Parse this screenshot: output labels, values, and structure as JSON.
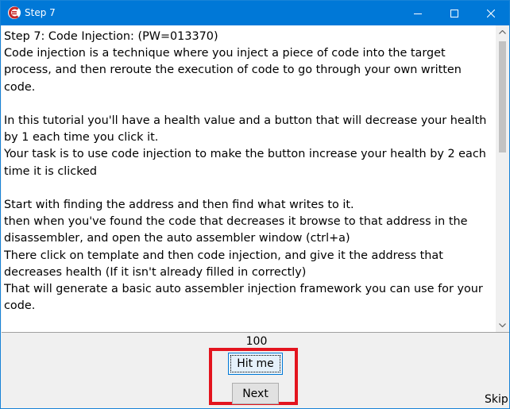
{
  "window": {
    "title": "Step 7"
  },
  "instructions": {
    "text": "Step 7: Code Injection: (PW=013370)\nCode injection is a technique where you inject a piece of code into the target process, and then reroute the execution of code to go through your own written code.\n\nIn this tutorial you'll have a health value and a button that will decrease your health by 1 each time you click it.\nYour task is to use code injection to make the button increase your health by 2 each time it is clicked\n\nStart with finding the address and then find what writes to it.\nthen when you've found the code that decreases it browse to that address in the disassembler, and open the auto assembler window (ctrl+a)\nThere click on template and then code injection, and give it the address that decreases health (If it isn't already filled in correctly)\nThat will generate a basic auto assembler injection framework you can use for your code.\n\nNotice the alloc, that will allocate a block of memory for your code cave, in the past, in the pre windows 2000 systems, people had to find code caves in the memory(regions of"
  },
  "health": {
    "value": "100"
  },
  "buttons": {
    "hit_me": "Hit me",
    "next": "Next",
    "skip": "Skip"
  },
  "colors": {
    "titlebar": "#0078d7",
    "highlight": "#e3141e",
    "app_icon": "#c62828"
  },
  "icons": {
    "app": "cheat-engine-icon",
    "minimize": "minimize-icon",
    "maximize": "maximize-icon",
    "close": "close-icon"
  }
}
